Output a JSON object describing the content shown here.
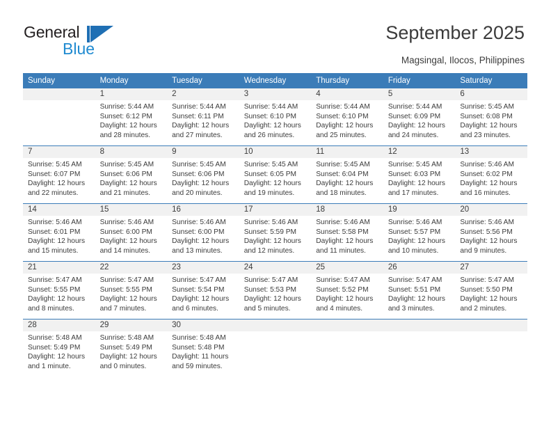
{
  "brand": {
    "name_top": "General",
    "name_bottom": "Blue",
    "accent_color": "#1f6fb4",
    "accent_color_light": "#1f8ad0"
  },
  "header": {
    "title": "September 2025",
    "subtitle": "Magsingal, Ilocos, Philippines"
  },
  "calendar": {
    "header_color": "#3b7cb8",
    "daynum_band_color": "#f1f1f1",
    "weekdays": [
      "Sunday",
      "Monday",
      "Tuesday",
      "Wednesday",
      "Thursday",
      "Friday",
      "Saturday"
    ],
    "labels": {
      "sunrise": "Sunrise:",
      "sunset": "Sunset:",
      "daylight": "Daylight:"
    },
    "weeks": [
      [
        {
          "day": "",
          "sunrise": "",
          "sunset": "",
          "daylight_1": "",
          "daylight_2": ""
        },
        {
          "day": "1",
          "sunrise": "Sunrise: 5:44 AM",
          "sunset": "Sunset: 6:12 PM",
          "daylight_1": "Daylight: 12 hours",
          "daylight_2": "and 28 minutes."
        },
        {
          "day": "2",
          "sunrise": "Sunrise: 5:44 AM",
          "sunset": "Sunset: 6:11 PM",
          "daylight_1": "Daylight: 12 hours",
          "daylight_2": "and 27 minutes."
        },
        {
          "day": "3",
          "sunrise": "Sunrise: 5:44 AM",
          "sunset": "Sunset: 6:10 PM",
          "daylight_1": "Daylight: 12 hours",
          "daylight_2": "and 26 minutes."
        },
        {
          "day": "4",
          "sunrise": "Sunrise: 5:44 AM",
          "sunset": "Sunset: 6:10 PM",
          "daylight_1": "Daylight: 12 hours",
          "daylight_2": "and 25 minutes."
        },
        {
          "day": "5",
          "sunrise": "Sunrise: 5:44 AM",
          "sunset": "Sunset: 6:09 PM",
          "daylight_1": "Daylight: 12 hours",
          "daylight_2": "and 24 minutes."
        },
        {
          "day": "6",
          "sunrise": "Sunrise: 5:45 AM",
          "sunset": "Sunset: 6:08 PM",
          "daylight_1": "Daylight: 12 hours",
          "daylight_2": "and 23 minutes."
        }
      ],
      [
        {
          "day": "7",
          "sunrise": "Sunrise: 5:45 AM",
          "sunset": "Sunset: 6:07 PM",
          "daylight_1": "Daylight: 12 hours",
          "daylight_2": "and 22 minutes."
        },
        {
          "day": "8",
          "sunrise": "Sunrise: 5:45 AM",
          "sunset": "Sunset: 6:06 PM",
          "daylight_1": "Daylight: 12 hours",
          "daylight_2": "and 21 minutes."
        },
        {
          "day": "9",
          "sunrise": "Sunrise: 5:45 AM",
          "sunset": "Sunset: 6:06 PM",
          "daylight_1": "Daylight: 12 hours",
          "daylight_2": "and 20 minutes."
        },
        {
          "day": "10",
          "sunrise": "Sunrise: 5:45 AM",
          "sunset": "Sunset: 6:05 PM",
          "daylight_1": "Daylight: 12 hours",
          "daylight_2": "and 19 minutes."
        },
        {
          "day": "11",
          "sunrise": "Sunrise: 5:45 AM",
          "sunset": "Sunset: 6:04 PM",
          "daylight_1": "Daylight: 12 hours",
          "daylight_2": "and 18 minutes."
        },
        {
          "day": "12",
          "sunrise": "Sunrise: 5:45 AM",
          "sunset": "Sunset: 6:03 PM",
          "daylight_1": "Daylight: 12 hours",
          "daylight_2": "and 17 minutes."
        },
        {
          "day": "13",
          "sunrise": "Sunrise: 5:46 AM",
          "sunset": "Sunset: 6:02 PM",
          "daylight_1": "Daylight: 12 hours",
          "daylight_2": "and 16 minutes."
        }
      ],
      [
        {
          "day": "14",
          "sunrise": "Sunrise: 5:46 AM",
          "sunset": "Sunset: 6:01 PM",
          "daylight_1": "Daylight: 12 hours",
          "daylight_2": "and 15 minutes."
        },
        {
          "day": "15",
          "sunrise": "Sunrise: 5:46 AM",
          "sunset": "Sunset: 6:00 PM",
          "daylight_1": "Daylight: 12 hours",
          "daylight_2": "and 14 minutes."
        },
        {
          "day": "16",
          "sunrise": "Sunrise: 5:46 AM",
          "sunset": "Sunset: 6:00 PM",
          "daylight_1": "Daylight: 12 hours",
          "daylight_2": "and 13 minutes."
        },
        {
          "day": "17",
          "sunrise": "Sunrise: 5:46 AM",
          "sunset": "Sunset: 5:59 PM",
          "daylight_1": "Daylight: 12 hours",
          "daylight_2": "and 12 minutes."
        },
        {
          "day": "18",
          "sunrise": "Sunrise: 5:46 AM",
          "sunset": "Sunset: 5:58 PM",
          "daylight_1": "Daylight: 12 hours",
          "daylight_2": "and 11 minutes."
        },
        {
          "day": "19",
          "sunrise": "Sunrise: 5:46 AM",
          "sunset": "Sunset: 5:57 PM",
          "daylight_1": "Daylight: 12 hours",
          "daylight_2": "and 10 minutes."
        },
        {
          "day": "20",
          "sunrise": "Sunrise: 5:46 AM",
          "sunset": "Sunset: 5:56 PM",
          "daylight_1": "Daylight: 12 hours",
          "daylight_2": "and 9 minutes."
        }
      ],
      [
        {
          "day": "21",
          "sunrise": "Sunrise: 5:47 AM",
          "sunset": "Sunset: 5:55 PM",
          "daylight_1": "Daylight: 12 hours",
          "daylight_2": "and 8 minutes."
        },
        {
          "day": "22",
          "sunrise": "Sunrise: 5:47 AM",
          "sunset": "Sunset: 5:55 PM",
          "daylight_1": "Daylight: 12 hours",
          "daylight_2": "and 7 minutes."
        },
        {
          "day": "23",
          "sunrise": "Sunrise: 5:47 AM",
          "sunset": "Sunset: 5:54 PM",
          "daylight_1": "Daylight: 12 hours",
          "daylight_2": "and 6 minutes."
        },
        {
          "day": "24",
          "sunrise": "Sunrise: 5:47 AM",
          "sunset": "Sunset: 5:53 PM",
          "daylight_1": "Daylight: 12 hours",
          "daylight_2": "and 5 minutes."
        },
        {
          "day": "25",
          "sunrise": "Sunrise: 5:47 AM",
          "sunset": "Sunset: 5:52 PM",
          "daylight_1": "Daylight: 12 hours",
          "daylight_2": "and 4 minutes."
        },
        {
          "day": "26",
          "sunrise": "Sunrise: 5:47 AM",
          "sunset": "Sunset: 5:51 PM",
          "daylight_1": "Daylight: 12 hours",
          "daylight_2": "and 3 minutes."
        },
        {
          "day": "27",
          "sunrise": "Sunrise: 5:47 AM",
          "sunset": "Sunset: 5:50 PM",
          "daylight_1": "Daylight: 12 hours",
          "daylight_2": "and 2 minutes."
        }
      ],
      [
        {
          "day": "28",
          "sunrise": "Sunrise: 5:48 AM",
          "sunset": "Sunset: 5:49 PM",
          "daylight_1": "Daylight: 12 hours",
          "daylight_2": "and 1 minute."
        },
        {
          "day": "29",
          "sunrise": "Sunrise: 5:48 AM",
          "sunset": "Sunset: 5:49 PM",
          "daylight_1": "Daylight: 12 hours",
          "daylight_2": "and 0 minutes."
        },
        {
          "day": "30",
          "sunrise": "Sunrise: 5:48 AM",
          "sunset": "Sunset: 5:48 PM",
          "daylight_1": "Daylight: 11 hours",
          "daylight_2": "and 59 minutes."
        },
        {
          "day": "",
          "sunrise": "",
          "sunset": "",
          "daylight_1": "",
          "daylight_2": ""
        },
        {
          "day": "",
          "sunrise": "",
          "sunset": "",
          "daylight_1": "",
          "daylight_2": ""
        },
        {
          "day": "",
          "sunrise": "",
          "sunset": "",
          "daylight_1": "",
          "daylight_2": ""
        },
        {
          "day": "",
          "sunrise": "",
          "sunset": "",
          "daylight_1": "",
          "daylight_2": ""
        }
      ]
    ]
  }
}
